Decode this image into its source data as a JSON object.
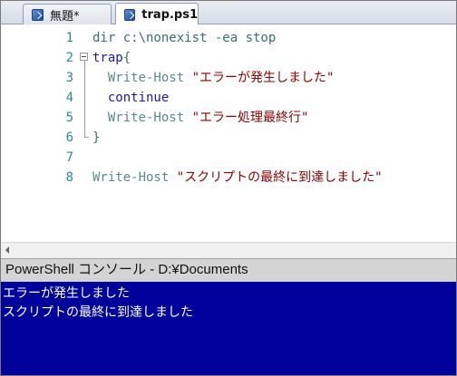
{
  "tabs": [
    {
      "label": "無題*",
      "active": false,
      "icon": "script-file-icon"
    },
    {
      "label": "trap.ps1",
      "active": true,
      "icon": "script-file-icon"
    }
  ],
  "editor": {
    "lines": [
      {
        "num": "1",
        "tokens": [
          {
            "t": "dir c:\\nonexist -ea stop",
            "c": "plain"
          }
        ]
      },
      {
        "num": "2",
        "tokens": [
          {
            "t": "trap",
            "c": "kw"
          },
          {
            "t": "{",
            "c": "plain"
          }
        ]
      },
      {
        "num": "3",
        "tokens": [
          {
            "t": "  Write-Host ",
            "c": "cmd"
          },
          {
            "t": "\"エラーが発生しました\"",
            "c": "str"
          }
        ]
      },
      {
        "num": "4",
        "tokens": [
          {
            "t": "  continue",
            "c": "kw"
          }
        ]
      },
      {
        "num": "5",
        "tokens": [
          {
            "t": "  Write-Host ",
            "c": "cmd"
          },
          {
            "t": "\"エラー処理最終行\"",
            "c": "str"
          }
        ]
      },
      {
        "num": "6",
        "tokens": [
          {
            "t": "}",
            "c": "plain"
          }
        ]
      },
      {
        "num": "7",
        "tokens": []
      },
      {
        "num": "8",
        "tokens": [
          {
            "t": "Write-Host ",
            "c": "cmd"
          },
          {
            "t": "\"スクリプトの最終に到達しました\"",
            "c": "str"
          }
        ]
      }
    ]
  },
  "console": {
    "title": "PowerShell コンソール - D:¥Documents",
    "output": [
      "エラーが発生しました",
      "スクリプトの最終に到達しました"
    ]
  },
  "colors": {
    "console_bg": "#00009a",
    "keyword": "#1a1aa6",
    "string": "#8b0000",
    "cmdlet": "#5a8a8a"
  }
}
